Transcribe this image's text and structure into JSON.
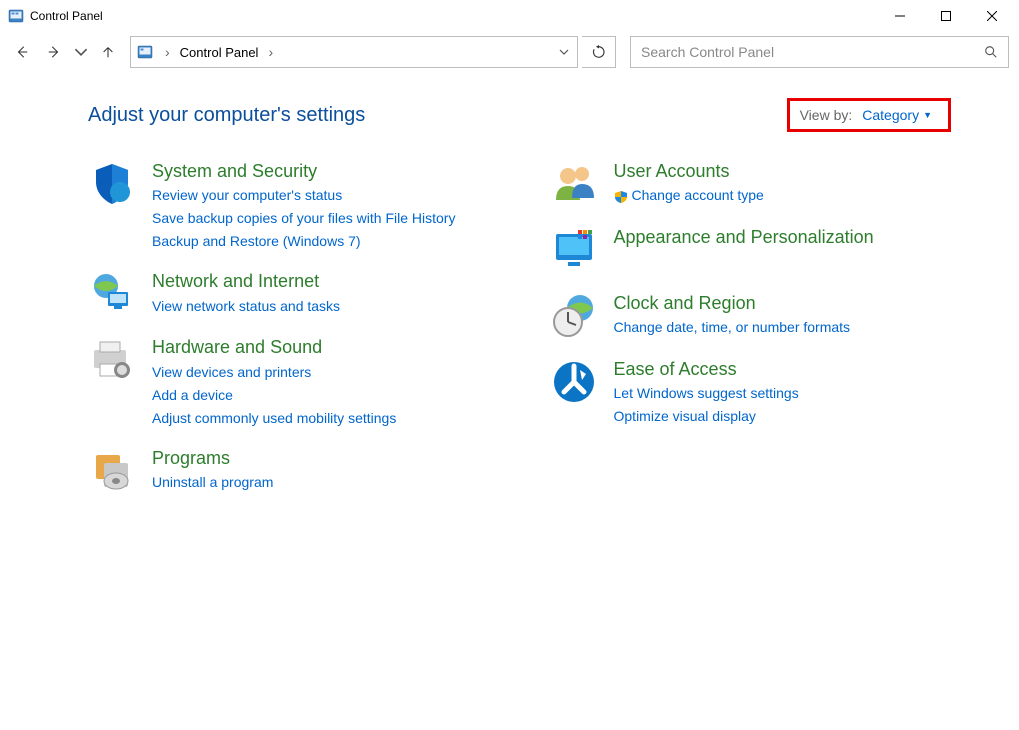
{
  "window": {
    "title": "Control Panel"
  },
  "breadcrumb": {
    "root": "Control Panel"
  },
  "search": {
    "placeholder": "Search Control Panel"
  },
  "heading": "Adjust your computer's settings",
  "viewby": {
    "label": "View by:",
    "value": "Category"
  },
  "categories": {
    "system_security": {
      "title": "System and Security",
      "links": [
        "Review your computer's status",
        "Save backup copies of your files with File History",
        "Backup and Restore (Windows 7)"
      ]
    },
    "network": {
      "title": "Network and Internet",
      "links": [
        "View network status and tasks"
      ]
    },
    "hardware": {
      "title": "Hardware and Sound",
      "links": [
        "View devices and printers",
        "Add a device",
        "Adjust commonly used mobility settings"
      ]
    },
    "programs": {
      "title": "Programs",
      "links": [
        "Uninstall a program"
      ]
    },
    "user_accounts": {
      "title": "User Accounts",
      "links": [
        "Change account type"
      ]
    },
    "appearance": {
      "title": "Appearance and Personalization",
      "links": []
    },
    "clock": {
      "title": "Clock and Region",
      "links": [
        "Change date, time, or number formats"
      ]
    },
    "ease": {
      "title": "Ease of Access",
      "links": [
        "Let Windows suggest settings",
        "Optimize visual display"
      ]
    }
  }
}
